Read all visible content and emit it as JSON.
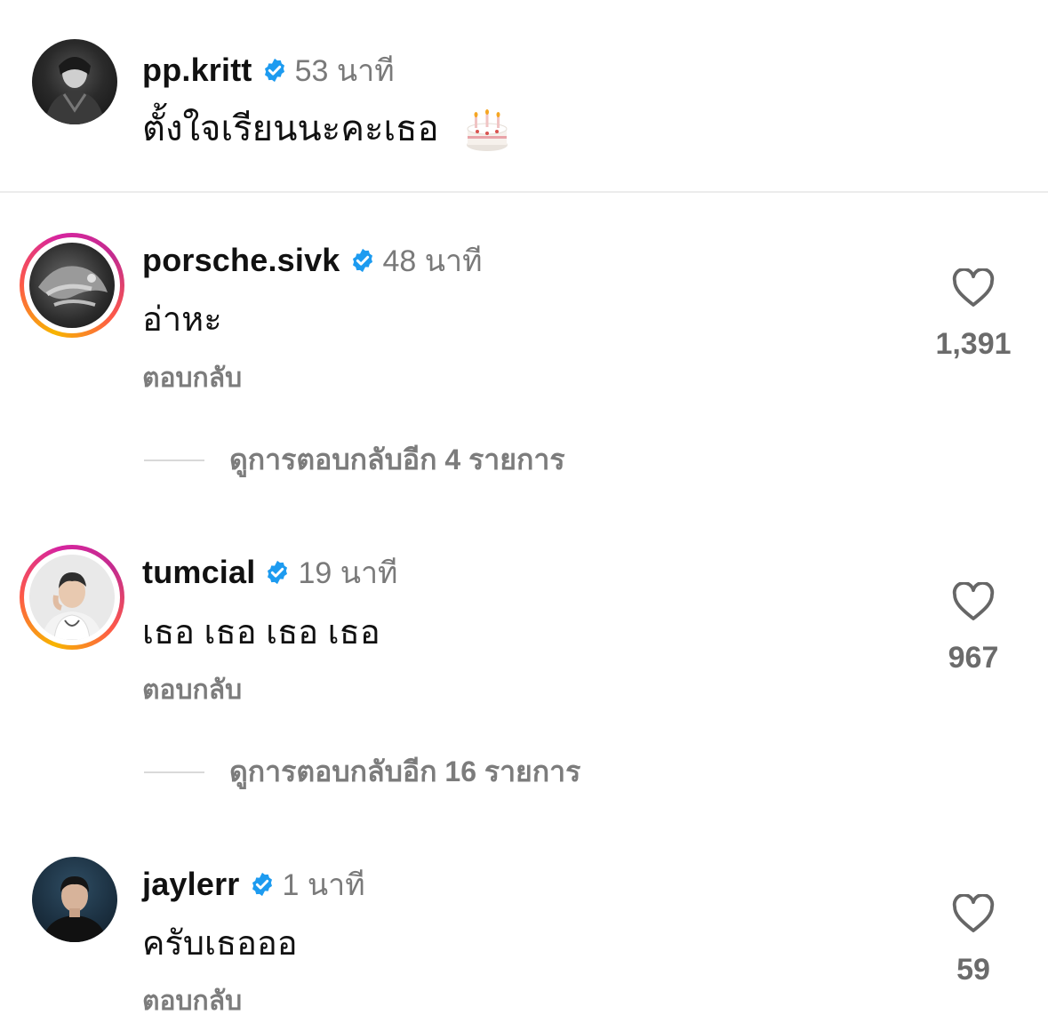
{
  "caption": {
    "username": "pp.kritt",
    "verified": true,
    "time": "53 นาที",
    "text": "ตั้งใจเรียนนะคะเธอ",
    "emoji_icon": "birthday-cake-icon"
  },
  "comments": [
    {
      "username": "porsche.sivk",
      "verified": true,
      "time": "48 นาที",
      "text": "อ่าหะ",
      "reply_label": "ตอบกลับ",
      "likes": "1,391",
      "view_replies": "ดูการตอบกลับอีก 4 รายการ",
      "story_ring": true
    },
    {
      "username": "tumcial",
      "verified": true,
      "time": "19 นาที",
      "text": "เธอ เธอ เธอ เธอ",
      "reply_label": "ตอบกลับ",
      "likes": "967",
      "view_replies": "ดูการตอบกลับอีก 16 รายการ",
      "story_ring": true
    },
    {
      "username": "jaylerr",
      "verified": true,
      "time": "1 นาที",
      "text": "ครับเธอออ",
      "reply_label": "ตอบกลับ",
      "likes": "59",
      "story_ring": false
    }
  ],
  "colors": {
    "verified_badge": "#1d9bf0",
    "secondary_text": "#7c7c7c",
    "divider": "#ececec"
  }
}
